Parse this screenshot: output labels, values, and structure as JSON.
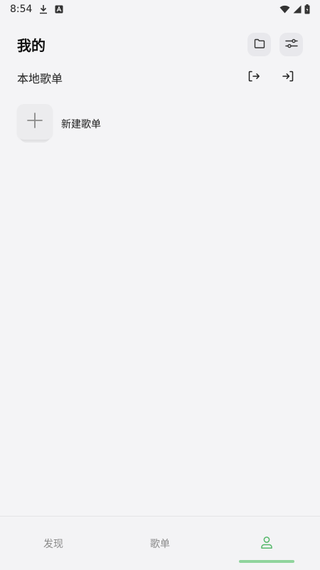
{
  "status": {
    "time": "8:54"
  },
  "header": {
    "title": "我的"
  },
  "section": {
    "title": "本地歌单"
  },
  "new_playlist": {
    "label": "新建歌单"
  },
  "nav": {
    "items": [
      {
        "label": "发现"
      },
      {
        "label": "歌单"
      },
      {
        "label": "",
        "icon": "user-icon",
        "active": true
      }
    ]
  },
  "colors": {
    "background": "#f4f4f6",
    "accent": "#8fd49d",
    "icon_button_bg": "#e8e8ec"
  }
}
